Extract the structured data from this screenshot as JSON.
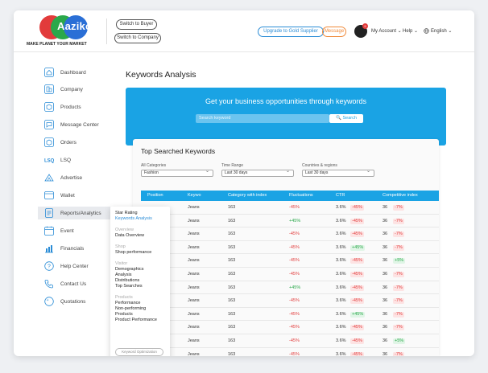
{
  "header": {
    "brand": "Aaziko",
    "tagline": "MAKE PLANET YOUR MARKET",
    "switch_buyer": "Switch to Buyer",
    "switch_company": "Switch to Company",
    "upgrade": "Upgrade to Gold Supplier",
    "message": "Message",
    "avatar_badge": "9",
    "my_account": "My Account ⌄",
    "help": "Help ⌄",
    "language": "English ⌄",
    "language_icon": "globe-icon"
  },
  "sidebar": {
    "items": [
      {
        "label": "Dashboard",
        "icon": "home-icon"
      },
      {
        "label": "Company",
        "icon": "building-icon"
      },
      {
        "label": "Products",
        "icon": "box-icon"
      },
      {
        "label": "Message Center",
        "icon": "chat-icon"
      },
      {
        "label": "Orders",
        "icon": "box-icon"
      },
      {
        "label": "LSQ",
        "icon": "lsq-icon"
      },
      {
        "label": "Advertise",
        "icon": "megaphone-icon"
      },
      {
        "label": "Wallet",
        "icon": "wallet-icon"
      },
      {
        "label": "Reports/Analytics",
        "icon": "report-icon"
      },
      {
        "label": "Event",
        "icon": "calendar-icon"
      },
      {
        "label": "Financials",
        "icon": "chart-icon"
      },
      {
        "label": "Help Center",
        "icon": "question-icon"
      },
      {
        "label": "Contact Us",
        "icon": "phone-icon"
      },
      {
        "label": "Quotations",
        "icon": "quote-icon"
      }
    ]
  },
  "submenu": {
    "star_rating": "Star Rating",
    "keywords_analysis": "Keywords Analysis",
    "overview_group": "Overview",
    "data_overview": "Data Overview",
    "shop_group": "Shop",
    "shop_performance": "Shop performance",
    "visitor_group": "Visitor",
    "demographics": "Demographics",
    "analysis": "Analysis",
    "distributions": "Distributions",
    "top_searches": "Top Searches",
    "products_group": "Products",
    "performance": "Performance",
    "non_performing": "Non-performing",
    "products_label": "Products",
    "product_performance": "Product Performance",
    "keyword_optimization": "Keyword Optimization"
  },
  "main": {
    "page_title": "Keywords Analysis",
    "banner_title": "Get your business opportunities through keywords",
    "search_placeholder": "Search keyword",
    "search_button": "🔍 Search",
    "card_title": "Top Searched Keywords",
    "filters": [
      {
        "label": "All Categories",
        "value": "Fashion"
      },
      {
        "label": "Time Range",
        "value": "Last 30 days"
      },
      {
        "label": "Countries & regions",
        "value": "Last 30 days"
      }
    ],
    "columns": [
      "Position",
      "Keywo",
      "Category with index",
      "Fluctuations",
      "CTR",
      "Competitive index"
    ],
    "rows": [
      {
        "kw": "Jeans",
        "cat": "163",
        "fluct": "-45%",
        "ctr": "3.6%",
        "ctr_chg": "-45%",
        "comp": "36",
        "comp_chg": "-7%"
      },
      {
        "kw": "Jeans",
        "cat": "163",
        "fluct": "+45%",
        "ctr": "3.6%",
        "ctr_chg": "-45%",
        "comp": "36",
        "comp_chg": "-7%"
      },
      {
        "kw": "Jeans",
        "cat": "163",
        "fluct": "-45%",
        "ctr": "3.6%",
        "ctr_chg": "-45%",
        "comp": "36",
        "comp_chg": "-7%"
      },
      {
        "kw": "Jeans",
        "cat": "163",
        "fluct": "-45%",
        "ctr": "3.6%",
        "ctr_chg": "+45%",
        "comp": "36",
        "comp_chg": "-7%"
      },
      {
        "kw": "Jeans",
        "cat": "163",
        "fluct": "-45%",
        "ctr": "3.6%",
        "ctr_chg": "-45%",
        "comp": "36",
        "comp_chg": "+5%"
      },
      {
        "kw": "Jeans",
        "cat": "163",
        "fluct": "-45%",
        "ctr": "3.6%",
        "ctr_chg": "-45%",
        "comp": "36",
        "comp_chg": "-7%"
      },
      {
        "kw": "Jeans",
        "cat": "163",
        "fluct": "+45%",
        "ctr": "3.6%",
        "ctr_chg": "-45%",
        "comp": "36",
        "comp_chg": "-7%"
      },
      {
        "kw": "Jeans",
        "cat": "163",
        "fluct": "-45%",
        "ctr": "3.6%",
        "ctr_chg": "-45%",
        "comp": "36",
        "comp_chg": "-7%"
      },
      {
        "kw": "Jeans",
        "cat": "163",
        "fluct": "-45%",
        "ctr": "3.6%",
        "ctr_chg": "+45%",
        "comp": "36",
        "comp_chg": "-7%"
      },
      {
        "kw": "Jeans",
        "cat": "163",
        "fluct": "-45%",
        "ctr": "3.6%",
        "ctr_chg": "-45%",
        "comp": "36",
        "comp_chg": "-7%"
      },
      {
        "kw": "Jeans",
        "cat": "163",
        "fluct": "-45%",
        "ctr": "3.6%",
        "ctr_chg": "-45%",
        "comp": "36",
        "comp_chg": "+5%"
      },
      {
        "kw": "Jeans",
        "cat": "163",
        "fluct": "-45%",
        "ctr": "3.6%",
        "ctr_chg": "-45%",
        "comp": "36",
        "comp_chg": "-7%"
      }
    ]
  },
  "colors": {
    "accent": "#1aa3e4",
    "negative": "#e23b3b",
    "positive": "#2aa84a",
    "message": "#f08a3a"
  }
}
